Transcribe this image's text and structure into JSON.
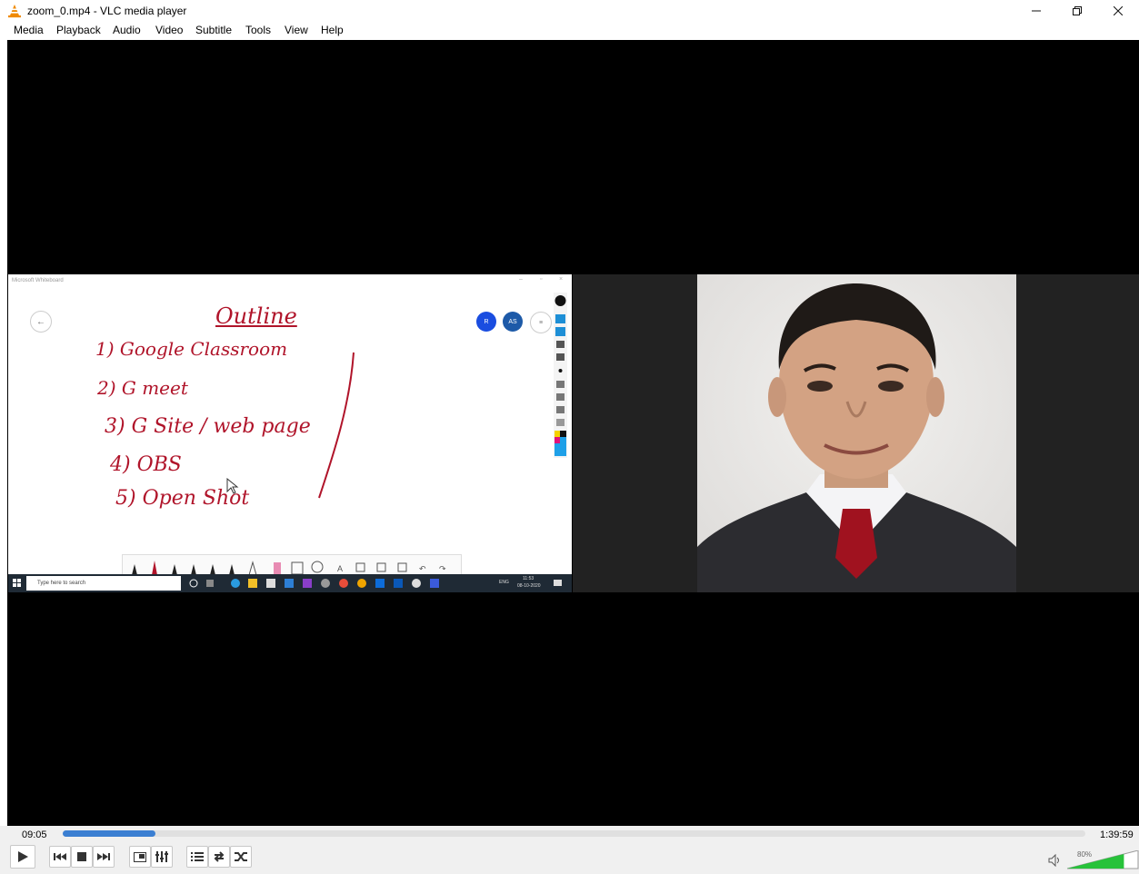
{
  "window": {
    "title": "zoom_0.mp4 - VLC media player",
    "minimize_icon": "minimize-icon",
    "restore_icon": "restore-icon",
    "close_icon": "close-icon"
  },
  "menu": [
    "Media",
    "Playback",
    "Audio",
    "Video",
    "Subtitle",
    "Tools",
    "View",
    "Help"
  ],
  "video": {
    "whiteboard": {
      "app_title": "Microsoft Whiteboard",
      "heading": "Outline",
      "items": [
        "1) Google Classroom",
        "2) G meet",
        "3) G Site / web page",
        "4) OBS",
        "5) Open Shot"
      ],
      "avatars": [
        "R",
        "AS"
      ],
      "taskbar_search": "Type here to search",
      "taskbar_lang": "ENG",
      "taskbar_time": "11:53",
      "taskbar_date": "08-10-2020"
    }
  },
  "playback": {
    "elapsed": "09:05",
    "total": "1:39:59",
    "progress_fraction": 0.091,
    "volume": "80%",
    "volume_fraction": 0.8,
    "accent_color": "#3b7fd2",
    "volume_color": "#27c23a"
  },
  "controls": {
    "play": "play-icon",
    "previous": "previous-icon",
    "stop": "stop-icon",
    "next": "next-icon",
    "fullscreen": "fullscreen-icon",
    "extended_settings": "equalizer-icon",
    "playlist": "playlist-icon",
    "loop": "loop-icon",
    "random": "shuffle-icon",
    "mute": "speaker-icon"
  }
}
